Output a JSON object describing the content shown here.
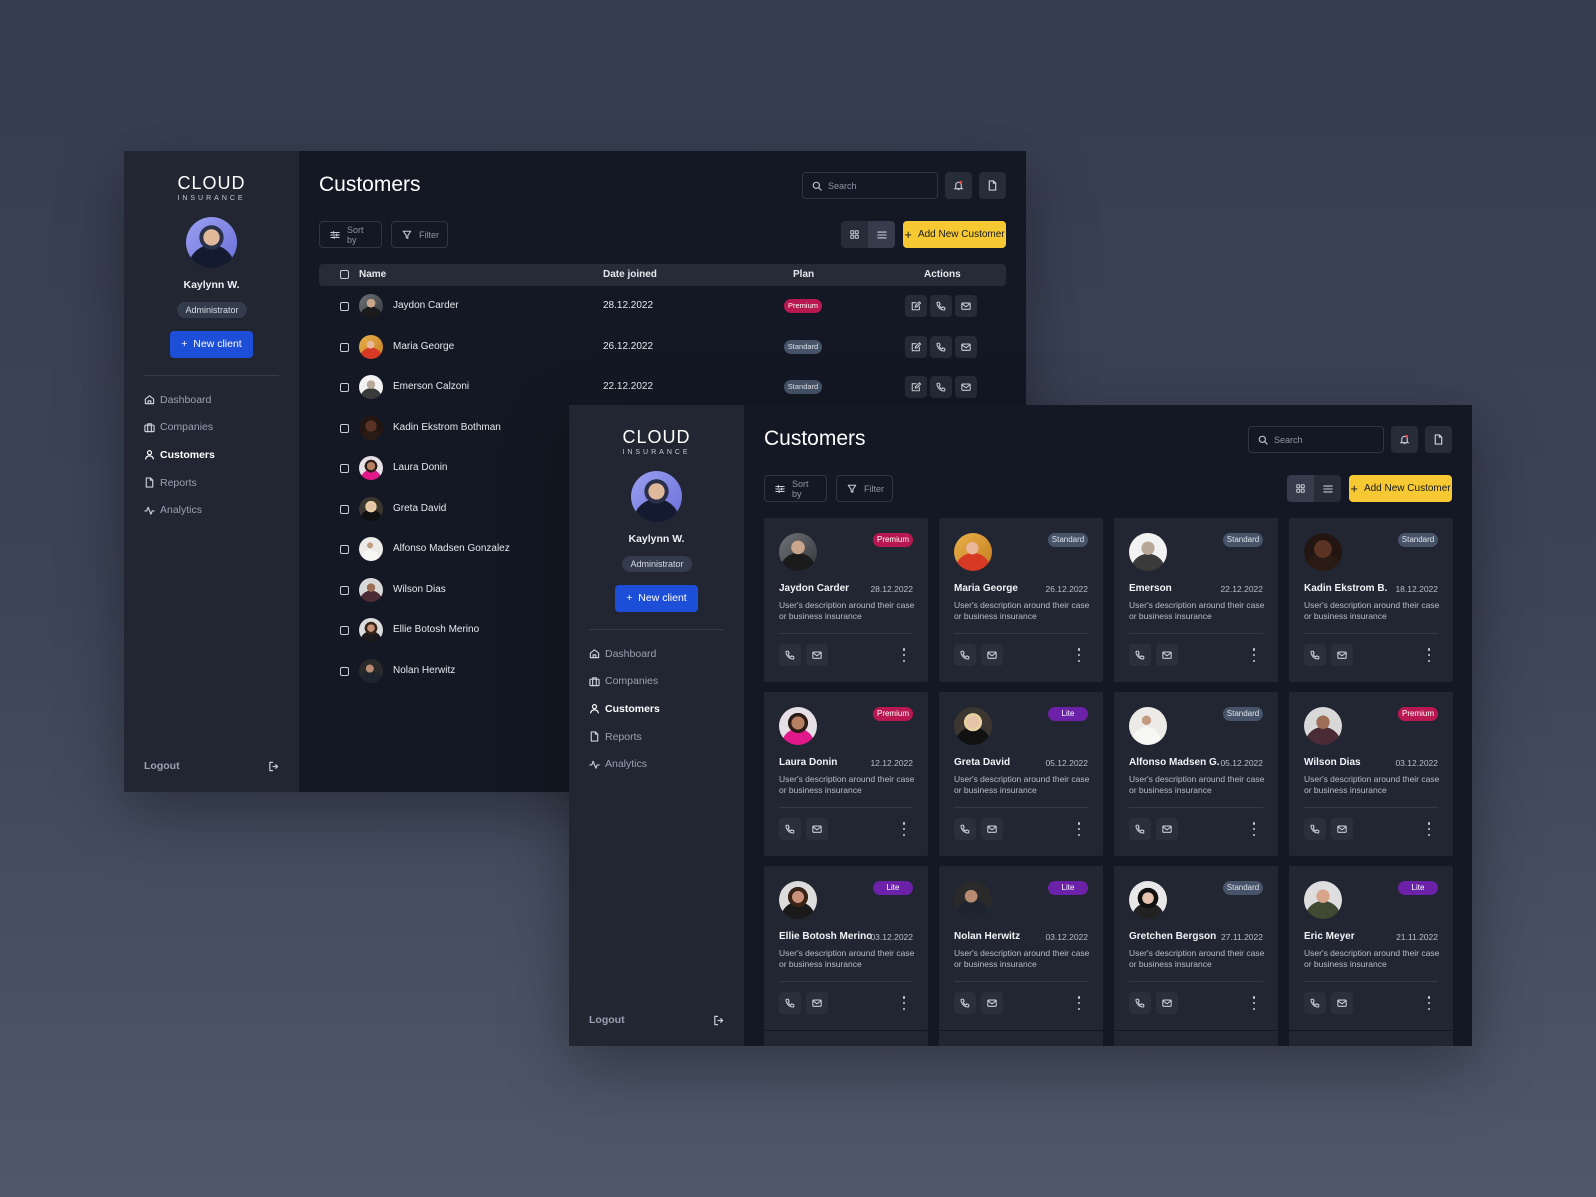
{
  "brand": {
    "name": "CLOUD",
    "sub": "INSURANCE"
  },
  "user": {
    "name": "Kaylynn W.",
    "role": "Administrator"
  },
  "sidebar": {
    "new_client": "New client",
    "items": [
      {
        "label": "Dashboard",
        "icon": "home-icon",
        "active": false
      },
      {
        "label": "Companies",
        "icon": "briefcase-icon",
        "active": false
      },
      {
        "label": "Customers",
        "icon": "user-icon",
        "active": true
      },
      {
        "label": "Reports",
        "icon": "file-icon",
        "active": false
      },
      {
        "label": "Analytics",
        "icon": "activity-icon",
        "active": false
      }
    ],
    "logout": "Logout"
  },
  "header": {
    "title": "Customers",
    "search_placeholder": "Search"
  },
  "toolbar": {
    "sort_by": "Sort by",
    "filter": "Filter",
    "add": "Add New Customer"
  },
  "colors": {
    "accent_blue": "#1d4ed8",
    "accent_yellow": "#f6c933",
    "premium": "#b8184f",
    "standard": "#465368",
    "lite": "#6b21a8"
  },
  "table": {
    "columns": [
      "Name",
      "Date joined",
      "Plan",
      "Actions"
    ],
    "rows": [
      {
        "name": "Jaydon Carder",
        "date": "28.12.2022",
        "plan": "Premium"
      },
      {
        "name": "Maria George",
        "date": "26.12.2022",
        "plan": "Standard"
      },
      {
        "name": "Emerson Calzoni",
        "date": "22.12.2022",
        "plan": "Standard"
      },
      {
        "name": "Kadin Ekstrom Bothman",
        "date": "",
        "plan": ""
      },
      {
        "name": "Laura Donin",
        "date": "",
        "plan": ""
      },
      {
        "name": "Greta David",
        "date": "",
        "plan": ""
      },
      {
        "name": "Alfonso Madsen Gonzalez",
        "date": "",
        "plan": ""
      },
      {
        "name": "Wilson Dias",
        "date": "",
        "plan": ""
      },
      {
        "name": "Ellie Botosh Merino",
        "date": "",
        "plan": ""
      },
      {
        "name": "Nolan Herwitz",
        "date": "",
        "plan": ""
      }
    ]
  },
  "cards": [
    {
      "name": "Jaydon Carder",
      "date": "28.12.2022",
      "plan": "Premium",
      "desc": "User's description around their case or business insurance"
    },
    {
      "name": "Maria George",
      "date": "26.12.2022",
      "plan": "Standard",
      "desc": "User's description around their case or business insurance"
    },
    {
      "name": "Emerson",
      "date": "22.12.2022",
      "plan": "Standard",
      "desc": "User's description around their case or business insurance"
    },
    {
      "name": "Kadin Ekstrom B.",
      "date": "18.12.2022",
      "plan": "Standard",
      "desc": "User's description around their case or business insurance"
    },
    {
      "name": "Laura Donin",
      "date": "12.12.2022",
      "plan": "Premium",
      "desc": "User's description around their case or business insurance"
    },
    {
      "name": "Greta David",
      "date": "05.12.2022",
      "plan": "Lite",
      "desc": "User's description around their case or business insurance"
    },
    {
      "name": "Alfonso Madsen G.",
      "date": "05.12.2022",
      "plan": "Standard",
      "desc": "User's description around their case or business insurance"
    },
    {
      "name": "Wilson Dias",
      "date": "03.12.2022",
      "plan": "Premium",
      "desc": "User's description around their case or business insurance"
    },
    {
      "name": "Ellie Botosh Merino",
      "date": "03.12.2022",
      "plan": "Lite",
      "desc": "User's description around their case or business insurance"
    },
    {
      "name": "Nolan Herwitz",
      "date": "03.12.2022",
      "plan": "Lite",
      "desc": "User's description around their case or business insurance"
    },
    {
      "name": "Gretchen Bergson",
      "date": "27.11.2022",
      "plan": "Standard",
      "desc": "User's description around their case or business insurance"
    },
    {
      "name": "Eric Meyer",
      "date": "21.11.2022",
      "plan": "Lite",
      "desc": "User's description around their case or business insurance"
    }
  ]
}
